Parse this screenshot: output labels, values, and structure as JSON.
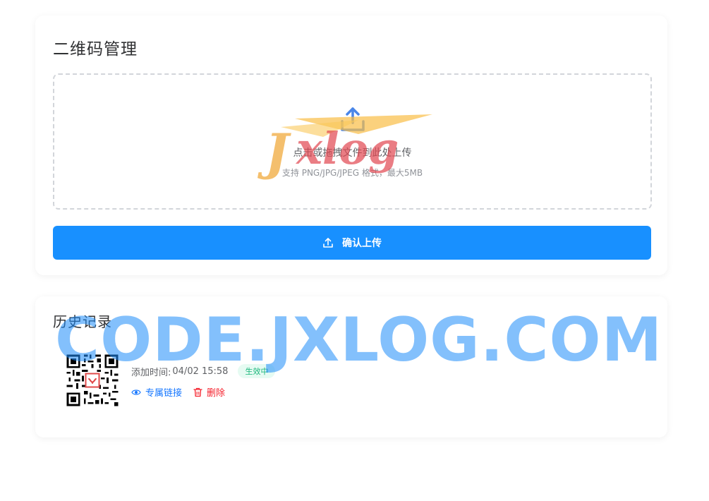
{
  "upload_card": {
    "title": "二维码管理",
    "dropzone": {
      "icon": "upload-icon",
      "title": "点击或拖拽文件到此处上传",
      "hint": "支持 PNG/JPG/JPEG 格式，最大5MB"
    },
    "confirm_button": {
      "icon": "upload-icon",
      "label": "确认上传"
    }
  },
  "history_card": {
    "title": "历史记录",
    "items": [
      {
        "qr_icon": "qr-code-thumbnail",
        "added_label": "添加时间:",
        "added_time": "04/02 15:58",
        "status": "生效中",
        "link_label": "专属链接",
        "delete_label": "删除"
      }
    ]
  },
  "watermark": {
    "logo_text": "Jxlog",
    "text": "CODE.JXLOG.COM"
  },
  "colors": {
    "primary": "#1890ff",
    "link": "#1677ff",
    "danger": "#f5222d",
    "status_green": "#19b57a",
    "status_bg": "#e6fbf2",
    "watermark_blue": "#1e8cfa"
  }
}
